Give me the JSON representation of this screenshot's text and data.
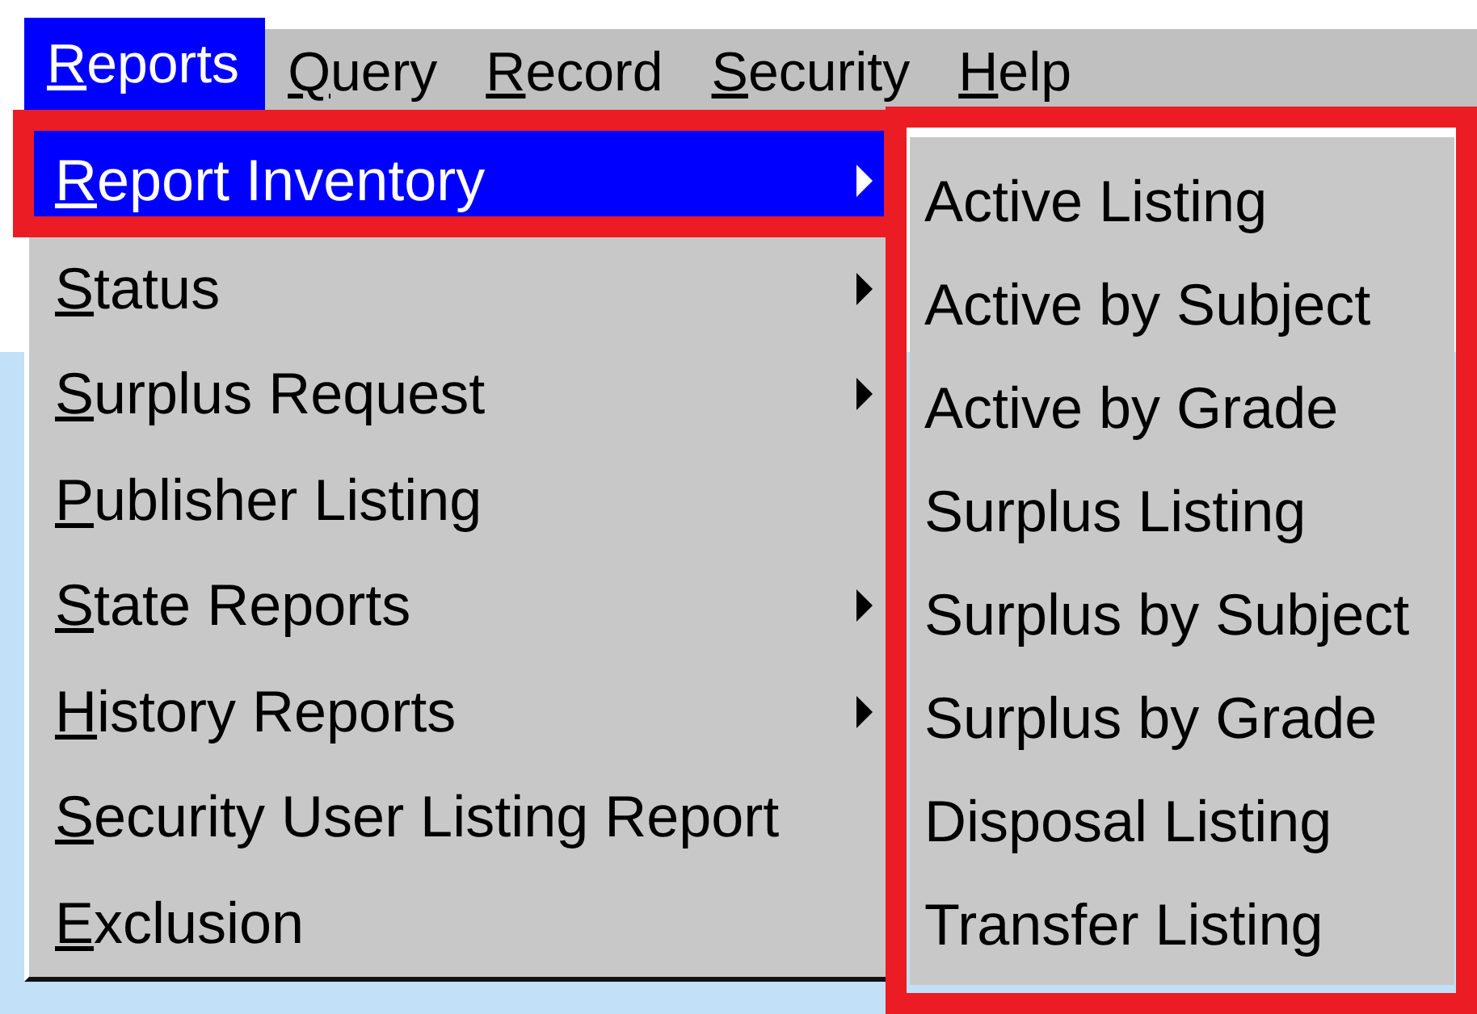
{
  "menubar": [
    {
      "label": "Reports",
      "selected": true
    },
    {
      "label": "Query",
      "selected": false
    },
    {
      "label": "Record",
      "selected": false
    },
    {
      "label": "Security",
      "selected": false
    },
    {
      "label": "Help",
      "selected": false
    }
  ],
  "menu": {
    "items": [
      {
        "label": "Report Inventory",
        "selected": true,
        "submenu": true,
        "outlined": true
      },
      {
        "label": "Status",
        "selected": false,
        "submenu": true,
        "outlined": false
      },
      {
        "label": "Surplus Request",
        "selected": false,
        "submenu": true,
        "outlined": false
      },
      {
        "label": "Publisher Listing",
        "selected": false,
        "submenu": false,
        "outlined": false
      },
      {
        "label": "State Reports",
        "selected": false,
        "submenu": true,
        "outlined": false
      },
      {
        "label": "History Reports",
        "selected": false,
        "submenu": true,
        "outlined": false
      },
      {
        "label": "Security User Listing Report",
        "selected": false,
        "submenu": false,
        "outlined": false
      },
      {
        "label": "Exclusion",
        "selected": false,
        "submenu": false,
        "outlined": false
      }
    ]
  },
  "submenu": {
    "outlined": true,
    "items": [
      {
        "label": "Active Listing",
        "selected": false
      },
      {
        "label": "Active by Subject",
        "selected": false
      },
      {
        "label": "Active by Grade",
        "selected": false
      },
      {
        "label": "Surplus Listing",
        "selected": false
      },
      {
        "label": "Surplus by Subject",
        "selected": false
      },
      {
        "label": "Surplus by Grade",
        "selected": false
      },
      {
        "label": "Disposal Listing",
        "selected": false
      },
      {
        "label": "Transfer Listing",
        "selected": false
      }
    ]
  }
}
